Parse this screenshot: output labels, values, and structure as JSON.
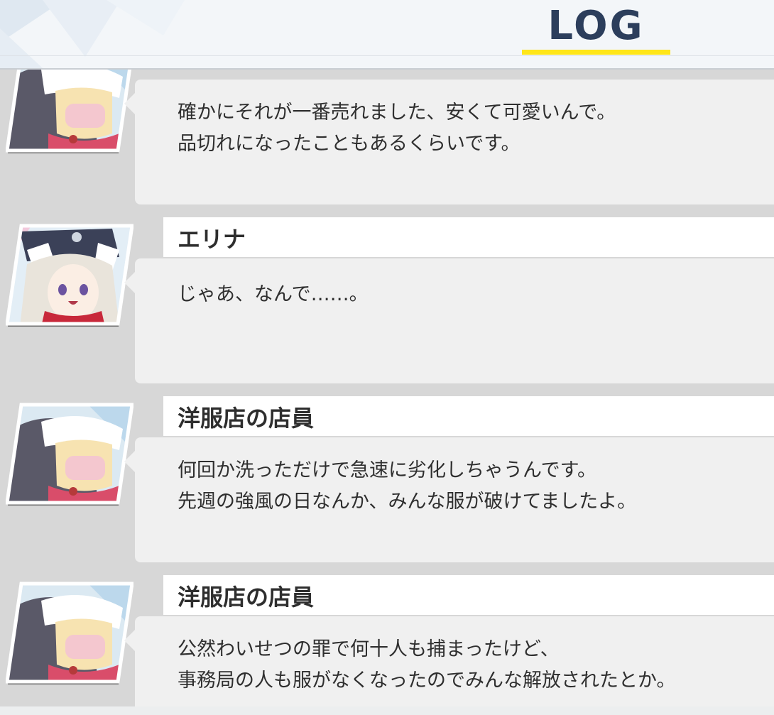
{
  "header": {
    "title": "LOG"
  },
  "entries": [
    {
      "name": "",
      "lines": [
        "確かにそれが一番売れました、安くて可愛いんで。",
        "品切れになったこともあるくらいです。"
      ],
      "avatar": "clerk-icon"
    },
    {
      "name": "エリナ",
      "lines": [
        "じゃあ、なんで……。"
      ],
      "avatar": "erina-icon"
    },
    {
      "name": "洋服店の店員",
      "lines": [
        "何回か洗っただけで急速に劣化しちゃうんです。",
        "先週の強風の日なんか、みんな服が破けてましたよ。"
      ],
      "avatar": "clerk-icon"
    },
    {
      "name": "洋服店の店員",
      "lines": [
        "公然わいせつの罪で何十人も捕まったけど、",
        "事務局の人も服がなくなったのでみんな解放されたとか。"
      ],
      "avatar": "clerk-icon"
    }
  ],
  "colors": {
    "accent_underline": "#ffe619",
    "title": "#2c3e5c",
    "bubble": "#f0f0f0",
    "background": "#d7d7d7"
  }
}
